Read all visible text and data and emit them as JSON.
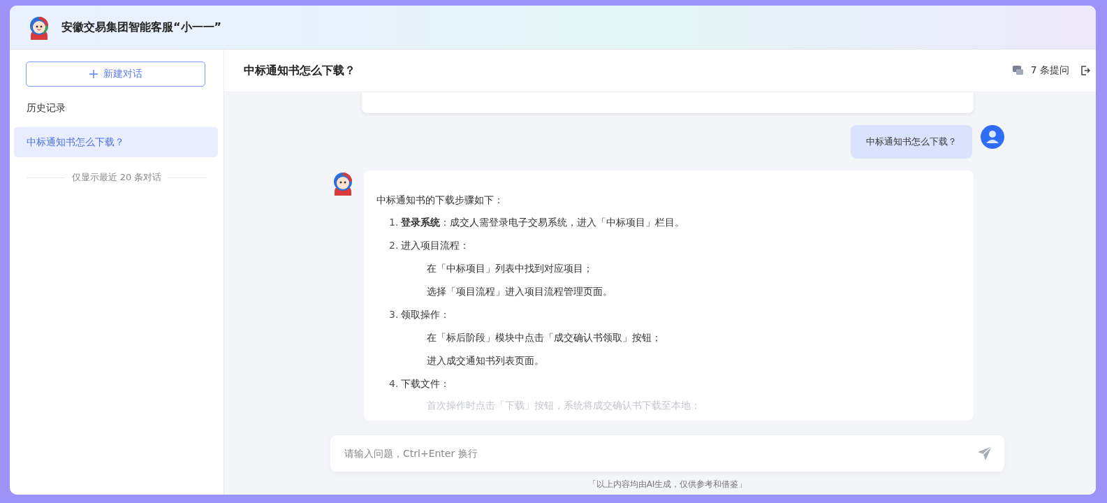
{
  "app": {
    "title": "安徽交易集团智能客服“小一一”"
  },
  "sidebar": {
    "new_chat_button": "新建对话",
    "history_heading": "历史记录",
    "history": [
      {
        "label": "中标通知书怎么下载？",
        "selected": true
      }
    ],
    "note": "仅显示最近 20 条对话"
  },
  "conversation": {
    "title": "中标通知书怎么下载？",
    "question_count": "7 条提问",
    "messages": [
      {
        "kind": "user",
        "text": "中标通知书怎么下载？"
      },
      {
        "kind": "bot",
        "intro": "中标通知书的下载步骤如下：",
        "steps": [
          {
            "number": "1.",
            "text": "**登录系统**：成交人需登录电子交易系统，进入「中标项目」栏目。"
          },
          {
            "number": "2.",
            "text": "进入项目流程：",
            "sub": [
              "在「中标项目」列表中找到对应项目；",
              "选择「项目流程」进入项目流程管理页面。"
            ]
          },
          {
            "number": "3.",
            "text": "领取操作：",
            "sub": [
              "在「标后阶段」模块中点击「成交确认书领取」按钮；",
              "进入成交通知书列表页面。"
            ]
          },
          {
            "number": "4.",
            "text": "下载文件：",
            "sub": [
              "首次操作时点击「下载」按钮，系统将成交确认书下载至本地；"
            ]
          }
        ]
      }
    ]
  },
  "input": {
    "placeholder": "请输入问题，Ctrl+Enter 换行"
  },
  "disclaimer": "「以上内容均由AI生成，仅供参考和借鉴」"
}
